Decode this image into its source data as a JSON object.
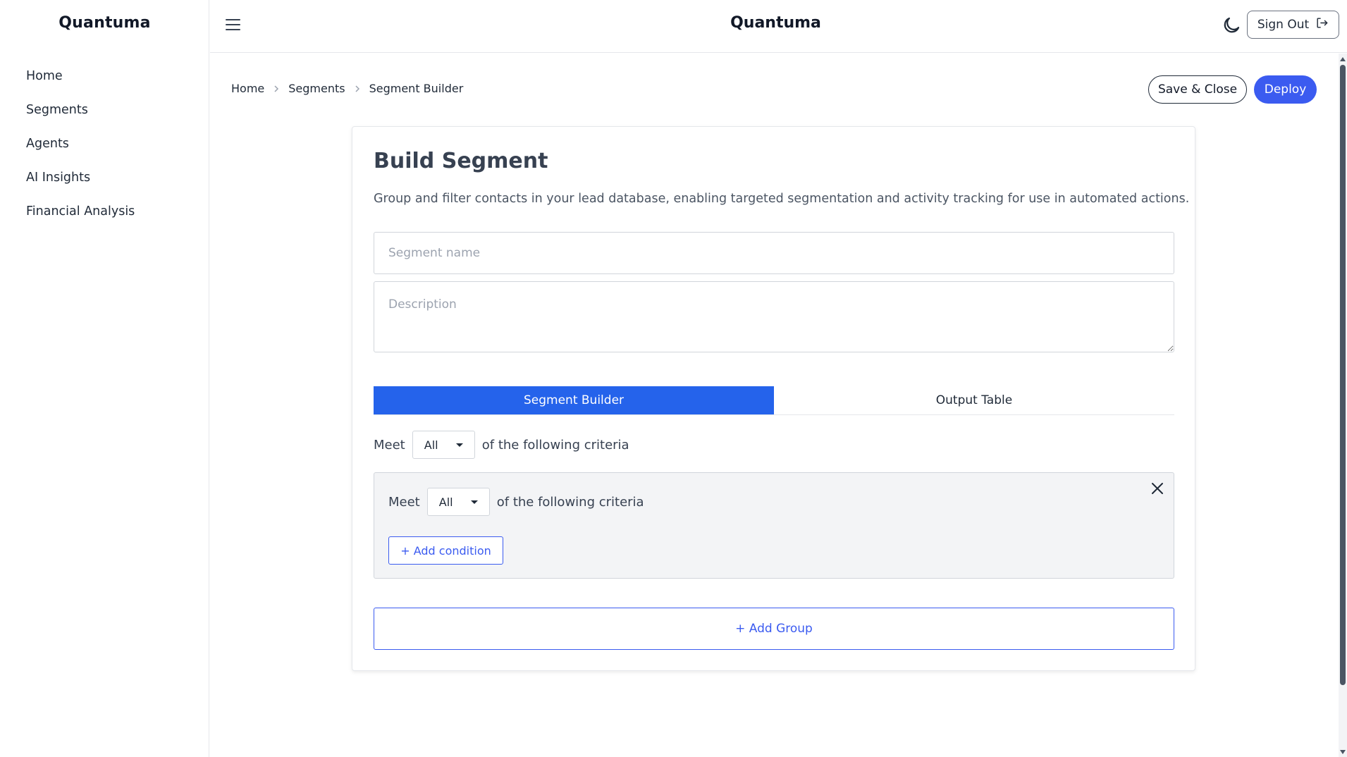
{
  "app": {
    "brand": "Quantuma",
    "header_title": "Quantuma"
  },
  "sidebar": {
    "items": [
      {
        "label": "Home"
      },
      {
        "label": "Segments"
      },
      {
        "label": "Agents"
      },
      {
        "label": "AI Insights"
      },
      {
        "label": "Financial Analysis"
      }
    ]
  },
  "header": {
    "menu_icon": "hamburger-menu-icon",
    "theme_icon": "moon-icon",
    "signout_label": "Sign Out",
    "signout_icon": "sign-out-icon"
  },
  "breadcrumb": [
    "Home",
    "Segments",
    "Segment Builder"
  ],
  "actions": {
    "save_label": "Save & Close",
    "deploy_label": "Deploy",
    "deploy_color": "#3b5bf0"
  },
  "card": {
    "title": "Build Segment",
    "description": "Group and filter contacts in your lead database, enabling targeted segmentation and activity tracking for use in automated actions.",
    "name_placeholder": "Segment name",
    "description_placeholder": "Description"
  },
  "tabs": [
    {
      "label": "Segment Builder",
      "active": true
    },
    {
      "label": "Output Table",
      "active": false
    }
  ],
  "criteria": {
    "prefix": "Meet",
    "selected": "All",
    "suffix": "of the following criteria"
  },
  "group": {
    "prefix": "Meet",
    "selected": "All",
    "suffix": "of the following criteria",
    "add_condition_label": "+ Add condition",
    "close_icon": "close-icon"
  },
  "add_group_label": "+ Add Group",
  "colors": {
    "accent": "#2563eb",
    "border": "#d1d5db",
    "group_bg": "#f3f4f6"
  }
}
